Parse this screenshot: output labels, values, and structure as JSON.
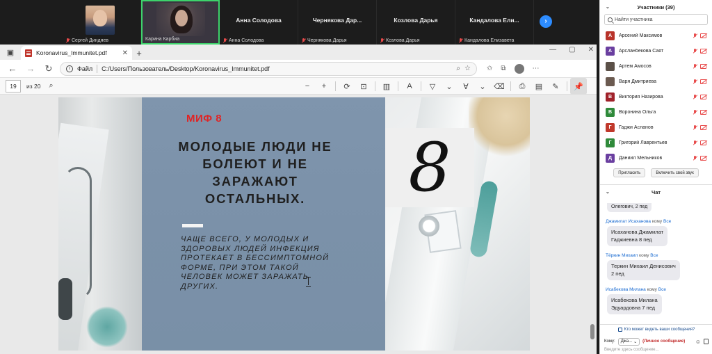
{
  "video_strip": {
    "tiles": [
      {
        "caption": "Сергей Диндяев"
      },
      {
        "caption": "Карина Карбиа"
      },
      {
        "name": "Анна Солодова",
        "caption": "Анна Солодова"
      },
      {
        "name": "Чернякова  Дар...",
        "caption": "Чернякова Дарья"
      },
      {
        "name": "Козлова Дарья",
        "caption": "Козлова Дарья"
      },
      {
        "name": "Кандалова  Ели...",
        "caption": "Кандалова Елизавета"
      }
    ],
    "next_icon": "›"
  },
  "browser": {
    "tab_title": "Koronavirus_Immunitet.pdf",
    "tab_close": "✕",
    "new_tab": "+",
    "window_controls": [
      "—",
      "▢",
      "✕"
    ],
    "address_label": "Файл",
    "url": "C:/Users/Пользователь/Desktop/Koronavirus_Immunitet.pdf",
    "page_number": "19",
    "page_total": "из 20"
  },
  "slide": {
    "myth_label": "МИФ 8",
    "headline": "МОЛОДЫЕ ЛЮДИ НЕ БОЛЕЮТ И НЕ ЗАРАЖАЮТ ОСТАЛЬНЫХ.",
    "body": "ЧАЩЕ ВСЕГО, У МОЛОДЫХ И ЗДОРОВЫХ ЛЮДЕЙ ИНФЕКЦИЯ ПРОТЕКАЕТ В БЕССИМПТОМНОЙ ФОРМЕ, ПРИ ЭТОМ ТАКОЙ ЧЕЛОВЕК МОЖЕТ ЗАРАЖАТЬ ДРУГИХ.",
    "number": "8"
  },
  "participants": {
    "title": "Участники (39)",
    "search_placeholder": "Найти участника",
    "items": [
      {
        "initial": "А",
        "name": "Арсений Максимов",
        "color": "#b8332a"
      },
      {
        "initial": "А",
        "name": "Арсланбекова Саят",
        "color": "#6a3fa0"
      },
      {
        "initial": "",
        "name": "Артем Амосов",
        "color": "#5b5048"
      },
      {
        "initial": "",
        "name": "Варя Дмитриева",
        "color": "#6b5a50"
      },
      {
        "initial": "В",
        "name": "Виктория Назирова",
        "color": "#a0222a"
      },
      {
        "initial": "В",
        "name": "Воронина Ольга",
        "color": "#2f8a3a"
      },
      {
        "initial": "Г",
        "name": "Гаджи Асланов",
        "color": "#c0392b"
      },
      {
        "initial": "Г",
        "name": "Григорий Лаврентьев",
        "color": "#2f8a3a"
      },
      {
        "initial": "Д",
        "name": "Даниил Мельников",
        "color": "#6a3fa0"
      }
    ],
    "invite_label": "Пригласить",
    "unmute_label": "Включить свой звук"
  },
  "chat": {
    "title": "Чат",
    "partial_message": "Олегович, 2 пед",
    "messages": [
      {
        "sender": "Джамилат Исаханова",
        "to_word": "кому",
        "recipient": "Все",
        "text_l1": "Исаханова Джамилат",
        "text_l2": "Гаджиевна 8 пед"
      },
      {
        "sender": "Тёркин Михаил",
        "to_word": "кому",
        "recipient": "Все",
        "text_l1": "Теркин Михаил Денисович",
        "text_l2": "2 пед"
      },
      {
        "sender": "Исабекова Милана",
        "to_word": "кому",
        "recipient": "Все",
        "text_l1": "Исабекова Милана",
        "text_l2": "Эдуардовна 7 пед"
      }
    ],
    "who_can_see": "Кто может видеть ваши сообщения?",
    "to_label": "Кому:",
    "to_value": "Джа...",
    "private_label": "(Личное сообщение)",
    "input_placeholder": "Введите здесь сообщение..."
  }
}
